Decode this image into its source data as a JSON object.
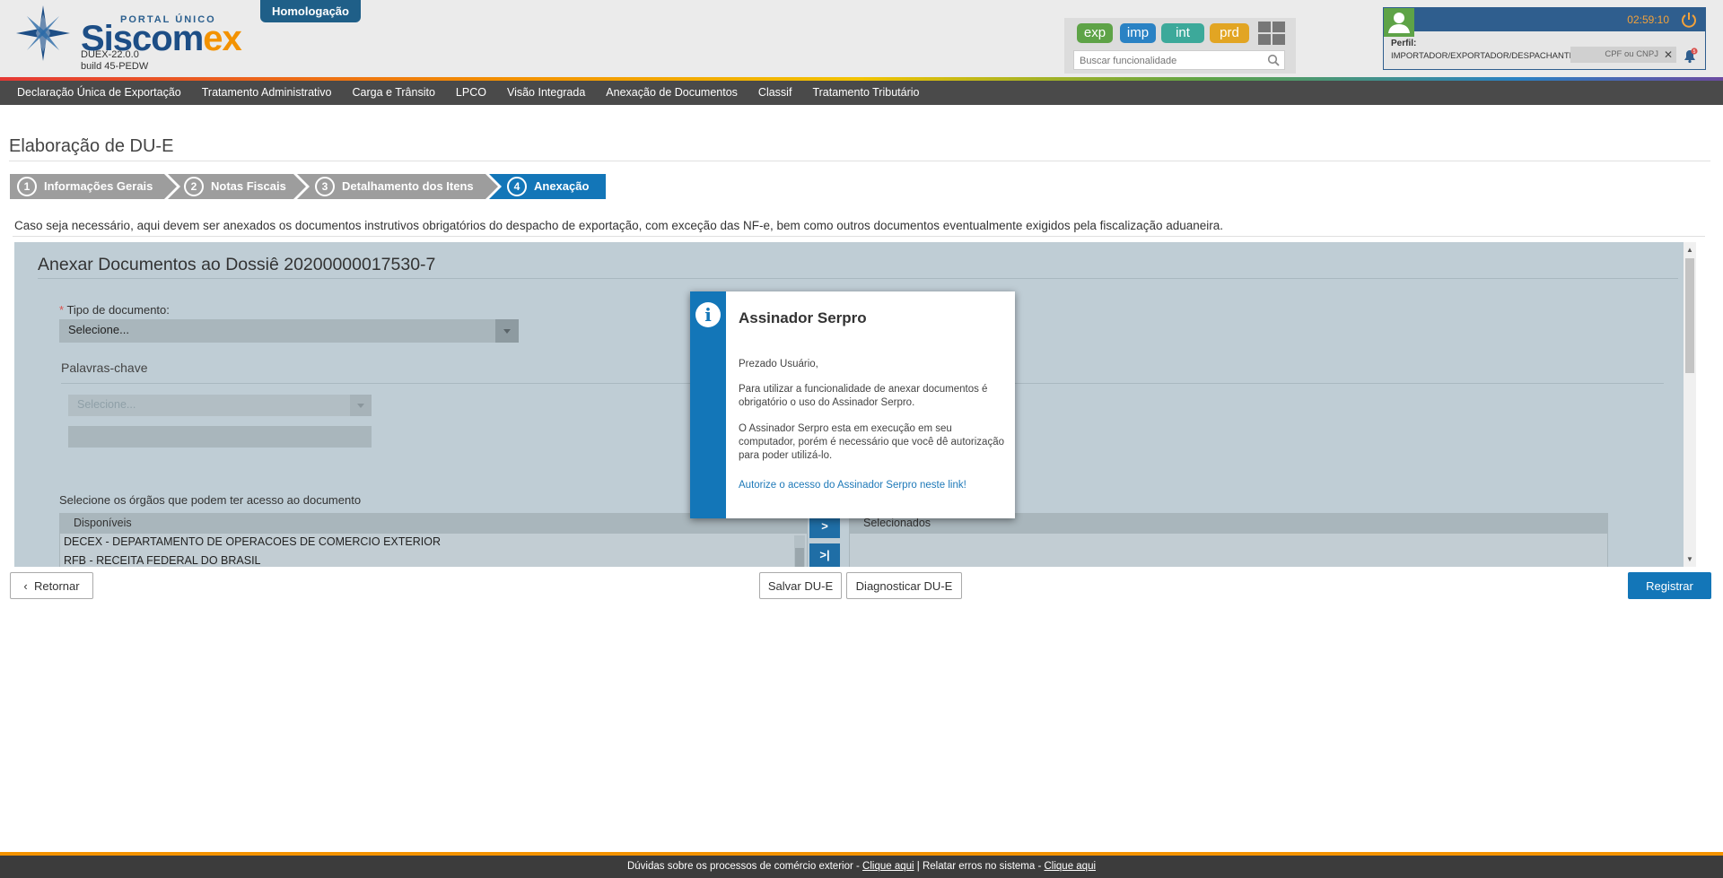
{
  "header": {
    "portal_label": "PORTAL ÚNICO",
    "brand_main": "Siscom",
    "brand_accent": "ex",
    "version": "DUEX-22.0.0",
    "build": "build 45-PEDW",
    "environment_badge": "Homologação",
    "systems": [
      "exp",
      "imp",
      "int",
      "prd"
    ],
    "search_placeholder": "Buscar funcionalidade",
    "clock": "02:59:10",
    "perfil_label": "Perfil:",
    "perfil_value": "IMPORTADOR/EXPORTADOR/DESPACHANTE",
    "cpf_placeholder": "CPF ou CNPJ",
    "notification_count": "5"
  },
  "menu": {
    "items": [
      "Declaração Única de Exportação",
      "Tratamento Administrativo",
      "Carga e Trânsito",
      "LPCO",
      "Visão Integrada",
      "Anexação de Documentos",
      "Classif",
      "Tratamento Tributário"
    ]
  },
  "page": {
    "title": "Elaboração de DU-E",
    "steps": [
      {
        "num": "1",
        "label": "Informações Gerais"
      },
      {
        "num": "2",
        "label": "Notas Fiscais"
      },
      {
        "num": "3",
        "label": "Detalhamento dos Itens"
      },
      {
        "num": "4",
        "label": "Anexação"
      }
    ],
    "active_step": 4,
    "intro": "Caso seja necessário, aqui devem ser anexados os documentos instrutivos obrigatórios do despacho de exportação, com exceção das NF-e, bem como outros documentos eventualmente exigidos pela fiscalização aduaneira."
  },
  "dossie": {
    "title": "Anexar Documentos ao Dossiê 20200000017530-7",
    "tipo_label": "Tipo de documento:",
    "tipo_required_mark": "*",
    "tipo_value": "Selecione...",
    "keywords_label": "Palavras-chave",
    "keywords_select_value": "Selecione...",
    "orgaos_label": "Selecione os órgãos que podem ter acesso ao documento",
    "available_header": "Disponíveis",
    "available_items": [
      "DECEX - DEPARTAMENTO DE OPERACOES DE COMERCIO EXTERIOR",
      "RFB - RECEITA FEDERAL DO BRASIL"
    ],
    "selected_header": "Selecionados",
    "move_one_label": ">",
    "move_all_label": ">|"
  },
  "modal": {
    "title": "Assinador Serpro",
    "greeting": "Prezado Usuário,",
    "paragraph1": "Para utilizar a funcionalidade de anexar documentos é obrigatório o uso do Assinador Serpro.",
    "paragraph2": "O Assinador Serpro esta em execução em seu computador, porém é necessário que você dê autorização para poder utilizá-lo.",
    "link": "Autorize o acesso do Assinador Serpro neste link!",
    "icon_glyph": "i"
  },
  "actions": {
    "back": "Retornar",
    "back_icon": "‹",
    "save": "Salvar DU-E",
    "diagnose": "Diagnosticar DU-E",
    "register": "Registrar"
  },
  "footer": {
    "text1": "Dúvidas sobre os processos de comércio exterior -",
    "link1": "Clique aqui",
    "separator": "|",
    "text2": "Relatar erros no sistema -",
    "link2": "Clique aqui"
  },
  "colors": {
    "primary": "#1376b8",
    "header_blue": "#2f5e8e",
    "accent_orange": "#f39200",
    "step_inactive": "#9d9d9d",
    "panel_bg": "#bfcdd5"
  }
}
